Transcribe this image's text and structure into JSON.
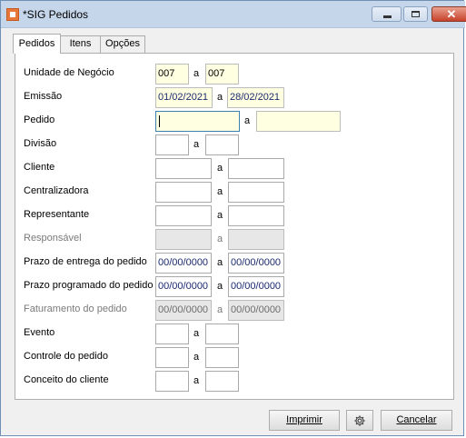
{
  "window": {
    "title": "*SIG Pedidos",
    "close_glyph": "✕",
    "app_icon": "sig-app-icon"
  },
  "tabs": [
    "Pedidos",
    "Itens",
    "Opções"
  ],
  "form": {
    "range_separator": "a",
    "rows": [
      {
        "label": "Unidade de Negócio",
        "from": "007",
        "to": "007"
      },
      {
        "label": "Emissão",
        "from": "01/02/2021",
        "to": "28/02/2021"
      },
      {
        "label": "Pedido",
        "from": "",
        "to": ""
      },
      {
        "label": "Divisão",
        "from": "",
        "to": ""
      },
      {
        "label": "Cliente",
        "from": "",
        "to": ""
      },
      {
        "label": "Centralizadora",
        "from": "",
        "to": ""
      },
      {
        "label": "Representante",
        "from": "",
        "to": ""
      },
      {
        "label": "Responsável",
        "from": "",
        "to": ""
      },
      {
        "label": "Prazo de entrega do pedido",
        "from": "00/00/0000",
        "to": "00/00/0000"
      },
      {
        "label": "Prazo programado do pedido",
        "from": "00/00/0000",
        "to": "00/00/0000"
      },
      {
        "label": "Faturamento do pedido",
        "from": "00/00/0000",
        "to": "00/00/0000"
      },
      {
        "label": "Evento",
        "from": "",
        "to": ""
      },
      {
        "label": "Controle do pedido",
        "from": "",
        "to": ""
      },
      {
        "label": "Conceito do cliente",
        "from": "",
        "to": ""
      }
    ]
  },
  "buttons": {
    "print": "Imprimir",
    "settings_icon": "gear-icon",
    "cancel": "Cancelar"
  },
  "colors": {
    "required_field": "#ffffe1",
    "disabled_field": "#e7e7e7",
    "title_bar": "#c5d6ea",
    "close_button": "#c6422a"
  }
}
